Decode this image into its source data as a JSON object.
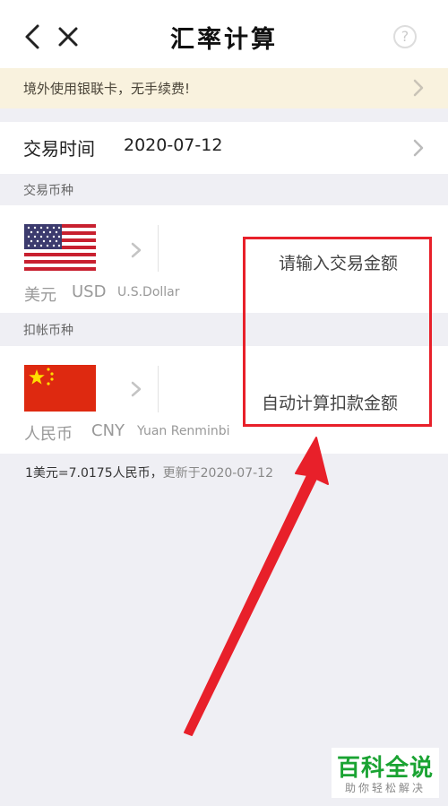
{
  "header": {
    "title": "汇率计算",
    "back_icon": "back-chevron-icon",
    "close_icon": "close-icon",
    "help_label": "?"
  },
  "notice": {
    "text": "境外使用银联卡，无手续费!"
  },
  "transaction_time": {
    "label": "交易时间",
    "value": "2020-07-12"
  },
  "transaction_currency": {
    "section_label": "交易币种",
    "name": "美元",
    "code": "USD",
    "english": "U.S.Dollar",
    "flag_icon": "us-flag-icon",
    "amount_placeholder": "请输入交易金额"
  },
  "debit_currency": {
    "section_label": "扣帐币种",
    "name": "人民币",
    "code": "CNY",
    "english": "Yuan Renminbi",
    "flag_icon": "china-flag-icon",
    "amount_placeholder": "自动计算扣款金额"
  },
  "rate": {
    "text": "1美元=7.0175人民币，",
    "updated": "更新于2020-07-12"
  },
  "annotation": {
    "color": "#e8202a"
  },
  "watermark": {
    "main": "百科全说",
    "sub": "助你轻松解决"
  },
  "colors": {
    "notice_bg": "#f9f2de",
    "page_bg": "#efeff4",
    "watermark_green": "#1aa332"
  }
}
